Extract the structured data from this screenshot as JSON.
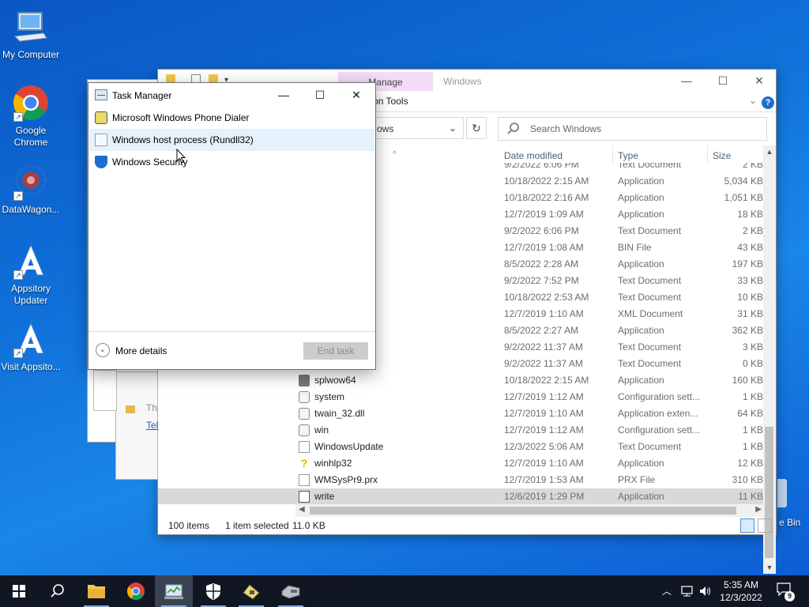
{
  "desktop": {
    "icons": [
      {
        "label": "My Computer"
      },
      {
        "label": "Google Chrome"
      },
      {
        "label": "DataWagon..."
      },
      {
        "label": "Appsitory Updater"
      },
      {
        "label": "Visit Appsito..."
      }
    ],
    "recycle_bin_label_fragment": "e Bin"
  },
  "explorer": {
    "title": "Windows",
    "manage_tab": "Manage",
    "ribbon_tools_label": "ation Tools",
    "address_text": "ows",
    "search_placeholder": "Search Windows",
    "columns": {
      "date": "Date modified",
      "type": "Type",
      "size": "Size"
    },
    "partial_top_row": {
      "date": "9/2/2022 6:06 PM",
      "type": "Text Document",
      "size": "2 KB"
    },
    "files": [
      {
        "name": "",
        "date": "10/18/2022 2:15 AM",
        "type": "Application",
        "size": "5,034 KB",
        "icon": "none"
      },
      {
        "name": "",
        "date": "10/18/2022 2:16 AM",
        "type": "Application",
        "size": "1,051 KB",
        "icon": "none"
      },
      {
        "name": "",
        "date": "12/7/2019 1:09 AM",
        "type": "Application",
        "size": "18 KB",
        "icon": "none"
      },
      {
        "name": "",
        "date": "9/2/2022 6:06 PM",
        "type": "Text Document",
        "size": "2 KB",
        "icon": "none"
      },
      {
        "name": "",
        "date": "12/7/2019 1:08 AM",
        "type": "BIN File",
        "size": "43 KB",
        "icon": "none"
      },
      {
        "name": "",
        "date": "8/5/2022 2:28 AM",
        "type": "Application",
        "size": "197 KB",
        "icon": "none"
      },
      {
        "name": "",
        "date": "9/2/2022 7:52 PM",
        "type": "Text Document",
        "size": "33 KB",
        "icon": "none"
      },
      {
        "name": "",
        "date": "10/18/2022 2:53 AM",
        "type": "Text Document",
        "size": "10 KB",
        "icon": "none"
      },
      {
        "name": "",
        "date": "12/7/2019 1:10 AM",
        "type": "XML Document",
        "size": "31 KB",
        "icon": "none"
      },
      {
        "name": "",
        "date": "8/5/2022 2:27 AM",
        "type": "Application",
        "size": "362 KB",
        "icon": "none"
      },
      {
        "name": "",
        "date": "9/2/2022 11:37 AM",
        "type": "Text Document",
        "size": "3 KB",
        "icon": "none"
      },
      {
        "name": "",
        "date": "9/2/2022 11:37 AM",
        "type": "Text Document",
        "size": "0 KB",
        "icon": "none"
      },
      {
        "name": "splwow64",
        "date": "10/18/2022 2:15 AM",
        "type": "Application",
        "size": "160 KB",
        "icon": "printer-icon"
      },
      {
        "name": "system",
        "date": "12/7/2019 1:12 AM",
        "type": "Configuration sett...",
        "size": "1 KB",
        "icon": "settings-file-icon"
      },
      {
        "name": "twain_32.dll",
        "date": "12/7/2019 1:10 AM",
        "type": "Application exten...",
        "size": "64 KB",
        "icon": "dll-file-icon"
      },
      {
        "name": "win",
        "date": "12/7/2019 1:12 AM",
        "type": "Configuration sett...",
        "size": "1 KB",
        "icon": "settings-file-icon"
      },
      {
        "name": "WindowsUpdate",
        "date": "12/3/2022 5:06 AM",
        "type": "Text Document",
        "size": "1 KB",
        "icon": "text-file-icon"
      },
      {
        "name": "winhlp32",
        "date": "12/7/2019 1:10 AM",
        "type": "Application",
        "size": "12 KB",
        "icon": "help-icon"
      },
      {
        "name": "WMSysPr9.prx",
        "date": "12/7/2019 1:53 AM",
        "type": "PRX File",
        "size": "310 KB",
        "icon": "blank-file-icon"
      },
      {
        "name": "write",
        "date": "12/6/2019 1:29 PM",
        "type": "Application",
        "size": "11 KB",
        "icon": "write-app-icon",
        "selected": true
      }
    ],
    "status": {
      "count": "100 items",
      "selected": "1 item selected",
      "size": "11.0 KB"
    }
  },
  "ghost": {
    "text_fragment": "Th",
    "link_fragment": "Tel"
  },
  "task_manager": {
    "title": "Task Manager",
    "processes": [
      {
        "label": "Microsoft Windows Phone Dialer",
        "icon": "phone-dialer-icon"
      },
      {
        "label": "Windows host process (Rundll32)",
        "icon": "rundll-icon",
        "hover": true
      },
      {
        "label": "Windows Security",
        "icon": "shield-icon"
      }
    ],
    "more_details": "More details",
    "end_task": "End task"
  },
  "taskbar": {
    "apps": [
      "start",
      "search",
      "file-explorer",
      "chrome",
      "task-manager",
      "windows-security",
      "phone-dialer",
      "fax"
    ],
    "clock_time": "5:35 AM",
    "clock_date": "12/3/2022",
    "notification_count": "9"
  },
  "colors": {
    "desktop": "#0f6fd8",
    "taskbar": "#101622",
    "manage_tab": "#f2dcf7",
    "accent": "#1d6ecf"
  }
}
